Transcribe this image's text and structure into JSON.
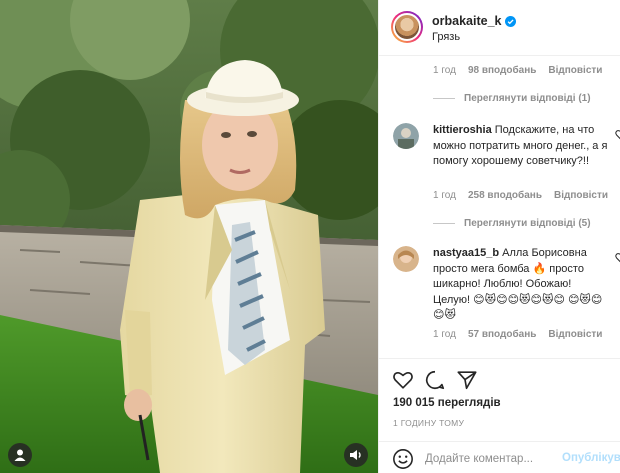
{
  "post": {
    "username": "orbakaite_k",
    "location": "Грязь",
    "verified_icon": "verified-badge-icon",
    "accent_color": "#0095f6"
  },
  "comments": [
    {
      "meta": {
        "time": "1 год",
        "likes": "98 вподобань",
        "reply": "Відповісти"
      },
      "view_replies": "Переглянути відповіді (1)"
    },
    {
      "username": "kittieroshia",
      "text": "Подскажите, на что можно потратить много денег., а я помогу хорошему советчику?!!",
      "meta": {
        "time": "1 год",
        "likes": "258 вподобань",
        "reply": "Відповісти"
      },
      "view_replies": "Переглянути відповіді (5)"
    },
    {
      "username": "nastyaa15_b",
      "text": "Алла Борисовна просто мега бомба 🔥 просто шикарно! Люблю! Обожаю! Целую! 😊😻😊😊😻😊😻😊 😊😻😊😊😻",
      "meta": {
        "time": "1 год",
        "likes": "57 вподобань",
        "reply": "Відповісти"
      }
    }
  ],
  "actions": {
    "like_icon": "heart-icon",
    "comment_icon": "comment-bubble-icon",
    "share_icon": "paper-plane-icon",
    "views": "190 015 переглядів",
    "timestamp": "1 ГОДИНУ ТОМУ"
  },
  "add_comment": {
    "placeholder": "Додайте коментар...",
    "publish_label": "Опублікувати",
    "emoji_icon": "smiley-icon"
  },
  "media": {
    "user_tag_icon": "user-tag-icon",
    "audio_icon": "speaker-icon"
  }
}
